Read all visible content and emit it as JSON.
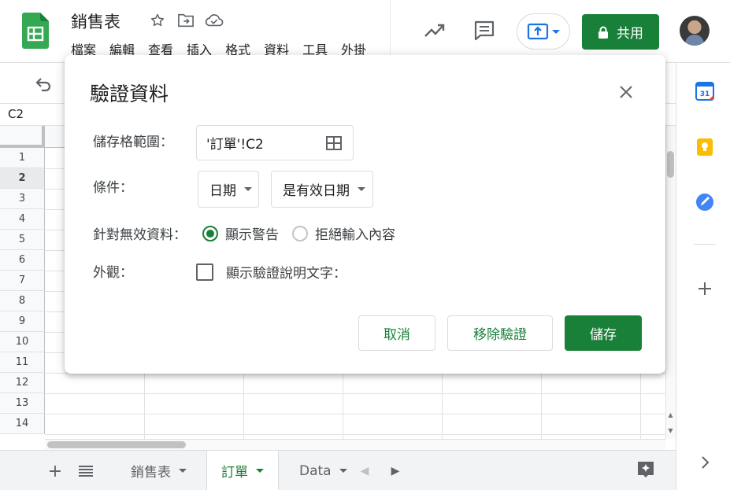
{
  "app": {
    "doc_title": "銷售表",
    "menu": [
      "檔案",
      "編輯",
      "查看",
      "插入",
      "格式",
      "資料",
      "工具",
      "外掛"
    ],
    "share_label": "共用",
    "colors": {
      "brand_green": "#188038",
      "sheets_green": "#34a853"
    }
  },
  "formula_bar": {
    "cell_ref": "C2"
  },
  "grid": {
    "row_numbers": [
      "1",
      "2",
      "3",
      "4",
      "5",
      "6",
      "7",
      "8",
      "9",
      "10",
      "11",
      "12",
      "13",
      "14"
    ],
    "selected_row": "2"
  },
  "sheet_tabs": [
    {
      "label": "銷售表",
      "active": false
    },
    {
      "label": "訂單",
      "active": true
    },
    {
      "label": "Data",
      "active": false
    }
  ],
  "dialog": {
    "title": "驗證資料",
    "range_label": "儲存格範圍：",
    "range_value": "'訂單'!C2",
    "criteria_label": "條件：",
    "criteria_type": "日期",
    "criteria_condition": "是有效日期",
    "invalid_label": "針對無效資料：",
    "invalid_options": [
      {
        "label": "顯示警告",
        "checked": true
      },
      {
        "label": "拒絕輸入內容",
        "checked": false
      }
    ],
    "appearance_label": "外觀：",
    "help_text_option": "顯示驗證說明文字：",
    "help_text_checked": false,
    "cancel_label": "取消",
    "remove_label": "移除驗證",
    "save_label": "儲存"
  },
  "icons": {
    "header": [
      "star-icon",
      "move-to-folder-icon",
      "cloud-saved-icon",
      "trending-up-icon",
      "comment-icon",
      "present-icon",
      "lock-icon"
    ],
    "side_panel": [
      "calendar-icon",
      "keep-icon",
      "tasks-icon",
      "add-icon",
      "expand-icon"
    ]
  }
}
